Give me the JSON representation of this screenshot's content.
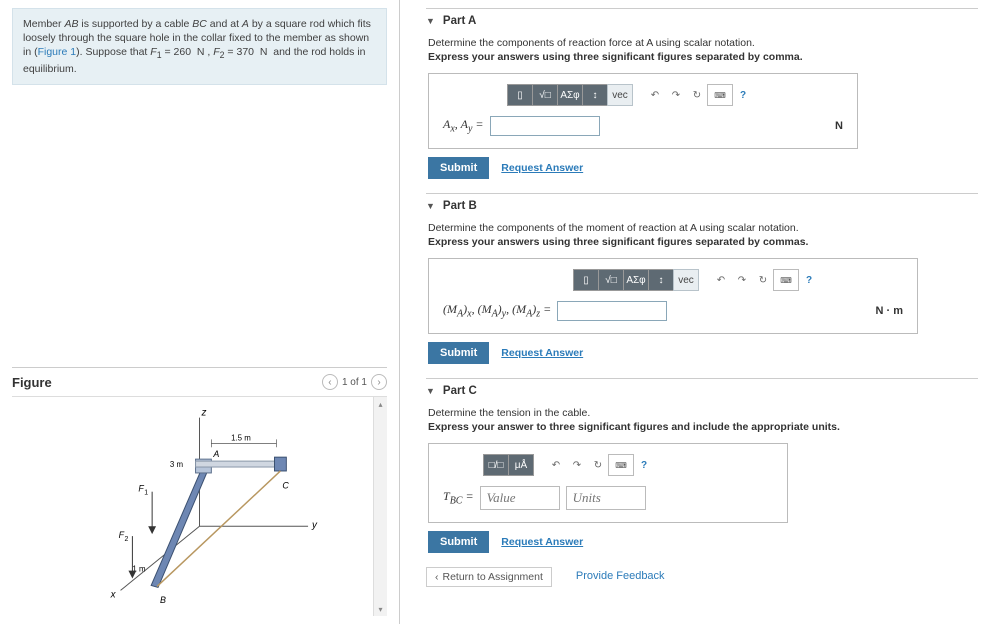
{
  "problem": {
    "text_parts": [
      "Member ",
      "AB",
      " is supported by a cable ",
      "BC",
      " and at ",
      "A",
      " by a square rod which fits loosely through the square hole in the collar fixed to the member as shown in (",
      "Figure 1",
      "). Suppose that ",
      "F",
      "1",
      " = 260  N , ",
      "F",
      "2",
      " = 370  N  and the rod holds in equilibrium."
    ]
  },
  "figure": {
    "title": "Figure",
    "pager": "1 of 1",
    "labels": {
      "z": "z",
      "y": "y",
      "x": "x",
      "A": "A",
      "B": "B",
      "C": "C",
      "F1": "F₁",
      "F2": "F₂",
      "d15": "1.5 m",
      "d3": "3 m",
      "d1": "1 m"
    }
  },
  "toolbar": {
    "templates": "",
    "sqrt": "√□",
    "greek": "ΑΣφ",
    "accent": "↕",
    "vec": "vec",
    "undo": "↶",
    "redo": "↷",
    "reset": "↻",
    "kbd": "⌨",
    "help": "?",
    "frac": "□□",
    "units": "μÅ"
  },
  "parts": {
    "a": {
      "title": "Part A",
      "inst": "Determine the components of reaction force at A using scalar notation.",
      "bold": "Express your answers using three significant figures separated by comma.",
      "label": "Aₓ, A_y =",
      "unit": "N",
      "submit": "Submit",
      "req": "Request Answer"
    },
    "b": {
      "title": "Part B",
      "inst": "Determine the components of the moment of reaction at A using scalar notation.",
      "bold": "Express your answers using three significant figures separated by commas.",
      "label": "(M_A)ₓ, (M_A)_y, (M_A)_z =",
      "unit": "N · m",
      "submit": "Submit",
      "req": "Request Answer"
    },
    "c": {
      "title": "Part C",
      "inst": "Determine the tension in the cable.",
      "bold": "Express your answer to three significant figures and include the appropriate units.",
      "label": "T_BC =",
      "value_ph": "Value",
      "units_ph": "Units",
      "submit": "Submit",
      "req": "Request Answer"
    }
  },
  "footer": {
    "return": "Return to Assignment",
    "feedback": "Provide Feedback"
  }
}
